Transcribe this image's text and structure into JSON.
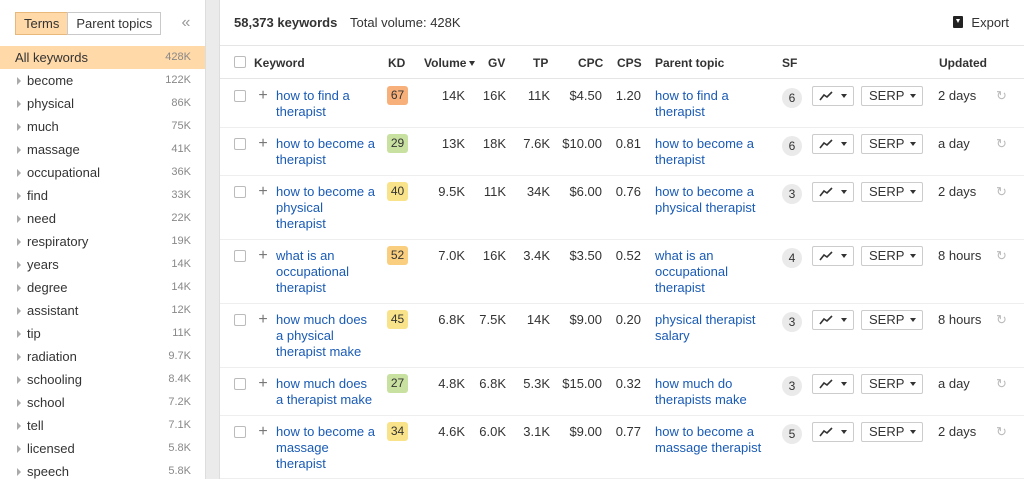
{
  "sidebar": {
    "tabs": [
      {
        "label": "Terms",
        "active": true
      },
      {
        "label": "Parent topics",
        "active": false
      }
    ],
    "collapse_icon": "double-chevron-left-icon",
    "items": [
      {
        "label": "All keywords",
        "count": "428K",
        "selected": true
      },
      {
        "label": "become",
        "count": "122K"
      },
      {
        "label": "physical",
        "count": "86K"
      },
      {
        "label": "much",
        "count": "75K"
      },
      {
        "label": "massage",
        "count": "41K"
      },
      {
        "label": "occupational",
        "count": "36K"
      },
      {
        "label": "find",
        "count": "33K"
      },
      {
        "label": "need",
        "count": "22K"
      },
      {
        "label": "respiratory",
        "count": "19K"
      },
      {
        "label": "years",
        "count": "14K"
      },
      {
        "label": "degree",
        "count": "14K"
      },
      {
        "label": "assistant",
        "count": "12K"
      },
      {
        "label": "tip",
        "count": "11K"
      },
      {
        "label": "radiation",
        "count": "9.7K"
      },
      {
        "label": "schooling",
        "count": "8.4K"
      },
      {
        "label": "school",
        "count": "7.2K"
      },
      {
        "label": "tell",
        "count": "7.1K"
      },
      {
        "label": "licensed",
        "count": "5.8K"
      },
      {
        "label": "speech",
        "count": "5.8K"
      }
    ]
  },
  "header": {
    "keywords_count": "58,373 keywords",
    "total_volume": "Total volume: 428K",
    "export_label": "Export"
  },
  "columns": {
    "keyword": "Keyword",
    "kd": "KD",
    "volume": "Volume",
    "gv": "GV",
    "tp": "TP",
    "cpc": "CPC",
    "cps": "CPS",
    "parent_topic": "Parent topic",
    "sf": "SF",
    "updated": "Updated"
  },
  "rows": [
    {
      "keyword": [
        "how to find a",
        "therapist"
      ],
      "kd": "67",
      "kd_color": "#f8b07a",
      "volume": "14K",
      "gv": "16K",
      "tp": "11K",
      "cpc": "$4.50",
      "cps": "1.20",
      "parent": [
        "how to find a",
        "therapist"
      ],
      "sf": "6",
      "serp": "SERP",
      "updated": "2 days"
    },
    {
      "keyword": [
        "how to become a",
        "therapist"
      ],
      "kd": "29",
      "kd_color": "#c8e0a0",
      "volume": "13K",
      "gv": "18K",
      "tp": "7.6K",
      "cpc": "$10.00",
      "cps": "0.81",
      "parent": [
        "how to become a",
        "therapist"
      ],
      "sf": "6",
      "serp": "SERP",
      "updated": "a day"
    },
    {
      "keyword": [
        "how to become a",
        "physical",
        "therapist"
      ],
      "kd": "40",
      "kd_color": "#f9e38a",
      "volume": "9.5K",
      "gv": "11K",
      "tp": "34K",
      "cpc": "$6.00",
      "cps": "0.76",
      "parent": [
        "how to become a",
        "physical therapist"
      ],
      "sf": "3",
      "serp": "SERP",
      "updated": "2 days"
    },
    {
      "keyword": [
        "what is an",
        "occupational",
        "therapist"
      ],
      "kd": "52",
      "kd_color": "#f9cf7f",
      "volume": "7.0K",
      "gv": "16K",
      "tp": "3.4K",
      "cpc": "$3.50",
      "cps": "0.52",
      "parent": [
        "what is an",
        "occupational",
        "therapist"
      ],
      "sf": "4",
      "serp": "SERP",
      "updated": "8 hours"
    },
    {
      "keyword": [
        "how much does",
        "a physical",
        "therapist make"
      ],
      "kd": "45",
      "kd_color": "#f9e38a",
      "volume": "6.8K",
      "gv": "7.5K",
      "tp": "14K",
      "cpc": "$9.00",
      "cps": "0.20",
      "parent": [
        "physical therapist",
        "salary"
      ],
      "sf": "3",
      "serp": "SERP",
      "updated": "8 hours"
    },
    {
      "keyword": [
        "how much does",
        "a therapist make"
      ],
      "kd": "27",
      "kd_color": "#c8e0a0",
      "volume": "4.8K",
      "gv": "6.8K",
      "tp": "5.3K",
      "cpc": "$15.00",
      "cps": "0.32",
      "parent": [
        "how much do",
        "therapists make"
      ],
      "sf": "3",
      "serp": "SERP",
      "updated": "a day"
    },
    {
      "keyword": [
        "how to become a",
        "massage",
        "therapist"
      ],
      "kd": "34",
      "kd_color": "#f9e38a",
      "volume": "4.6K",
      "gv": "6.0K",
      "tp": "3.1K",
      "cpc": "$9.00",
      "cps": "0.77",
      "parent": [
        "how to become a",
        "massage therapist"
      ],
      "sf": "5",
      "serp": "SERP",
      "updated": "2 days"
    }
  ]
}
